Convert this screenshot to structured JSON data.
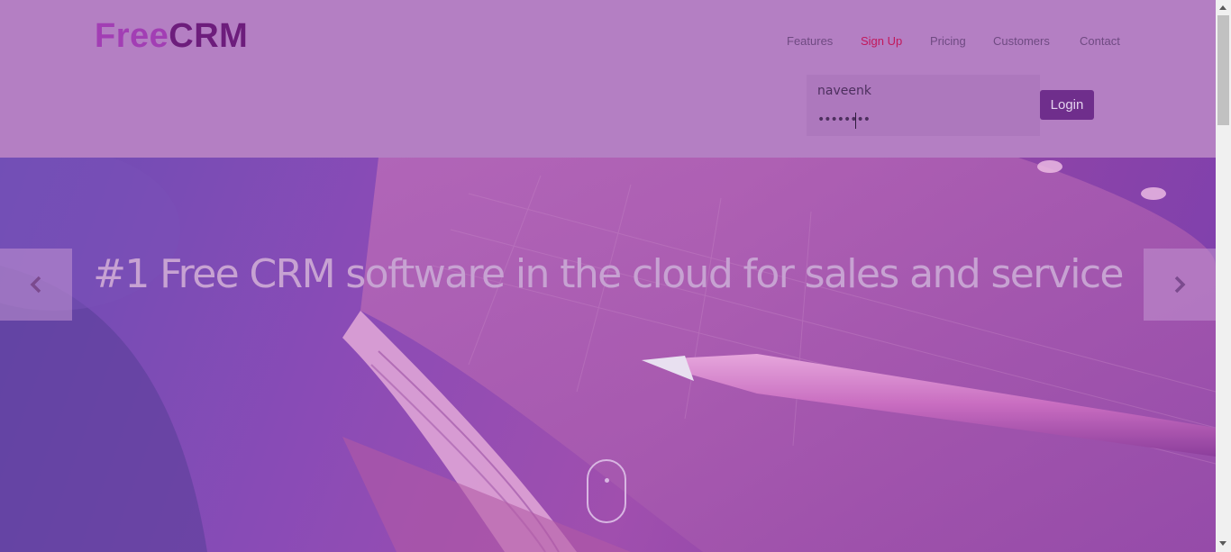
{
  "header": {
    "logo_free": "Free",
    "logo_crm": "CRM",
    "nav": {
      "features": "Features",
      "signup": "Sign Up",
      "pricing": "Pricing",
      "customers": "Customers",
      "contact": "Contact"
    },
    "login": {
      "username_value": "naveenk",
      "password_value": "••••••••",
      "button_label": "Login"
    }
  },
  "hero": {
    "title": "#1 Free CRM software in the cloud for sales and service",
    "prev_icon": "chevron-left-icon",
    "next_icon": "chevron-right-icon",
    "scroll_icon": "mouse-scroll-icon"
  },
  "colors": {
    "header_bg": "#b47fc3",
    "logo_free": "#a23eb4",
    "logo_crm": "#6d1d7c",
    "nav_text": "#6f4a82",
    "nav_active": "#c2185b",
    "login_button": "#6f2e8c",
    "hero_title": "#c7a2d2"
  }
}
